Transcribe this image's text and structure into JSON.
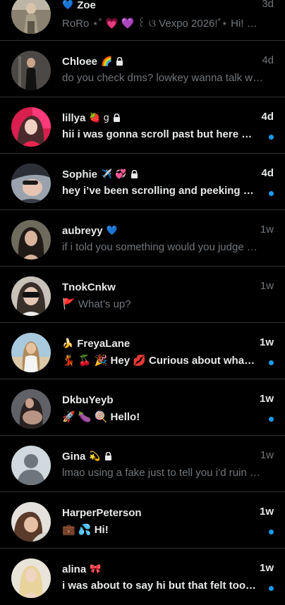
{
  "conversations": [
    {
      "name": "Zoe",
      "name_prefix_emoji": "💙",
      "name_suffix_emoji": "",
      "locked": false,
      "time": "3d",
      "preview": "RoRo ⋆˚ 💗 💜 ꒰ ଓ Vexpo 2026!˚⋆ Hi!   😤 ...",
      "unread": false,
      "avatar_icon": "photo-avatar"
    },
    {
      "name": "Chloee",
      "name_prefix_emoji": "",
      "name_suffix_emoji": "🌈",
      "locked": true,
      "time": "4d",
      "preview": "do you check dms? lowkey wanna talk with you",
      "unread": false,
      "avatar_icon": "photo-avatar"
    },
    {
      "name": "lillya",
      "name_prefix_emoji": "",
      "name_suffix_emoji": "🍓 g",
      "locked": true,
      "time": "4d",
      "preview": "hii i was gonna scroll past but here we are",
      "unread": true,
      "avatar_icon": "photo-avatar"
    },
    {
      "name": "Sophie",
      "name_prefix_emoji": "",
      "name_suffix_emoji": "✈️ 💞",
      "locked": true,
      "time": "4d",
      "preview": "hey i’ve been scrolling and peeking at your page",
      "unread": true,
      "avatar_icon": "photo-avatar"
    },
    {
      "name": "aubreyy",
      "name_prefix_emoji": "",
      "name_suffix_emoji": "💙",
      "locked": false,
      "time": "1w",
      "preview": "if i told you something would you judge me?",
      "unread": false,
      "avatar_icon": "photo-avatar"
    },
    {
      "name": "TnokCnkw",
      "name_prefix_emoji": "",
      "name_suffix_emoji": "",
      "locked": false,
      "time": "1w",
      "preview": "🚩 What’s up?",
      "unread": false,
      "avatar_icon": "photo-avatar"
    },
    {
      "name": "FreyaLane",
      "name_prefix_emoji": "🍌",
      "name_suffix_emoji": "",
      "locked": false,
      "time": "1w",
      "preview": "💃 🍒 🎉 Hey 💋 Curious about what you’re into",
      "unread": true,
      "avatar_icon": "photo-avatar"
    },
    {
      "name": "DkbuYeyb",
      "name_prefix_emoji": "",
      "name_suffix_emoji": "",
      "locked": false,
      "time": "1w",
      "preview": "🚀 🍆 🍭 Hello!",
      "unread": true,
      "avatar_icon": "photo-avatar"
    },
    {
      "name": "Gina",
      "name_prefix_emoji": "",
      "name_suffix_emoji": "💫",
      "locked": true,
      "time": "1w",
      "preview": "lmao using a fake just to tell you i’d ruin you",
      "unread": false,
      "avatar_icon": "default-avatar"
    },
    {
      "name": "HarperPeterson",
      "name_prefix_emoji": "",
      "name_suffix_emoji": "",
      "locked": false,
      "time": "1w",
      "preview": "💼 💦 Hi!",
      "unread": true,
      "avatar_icon": "photo-avatar"
    },
    {
      "name": "alina",
      "name_prefix_emoji": "",
      "name_suffix_emoji": "🎀",
      "locked": false,
      "time": "1w",
      "preview": "i was about to say hi but that felt too normal",
      "unread": true,
      "avatar_icon": "photo-avatar"
    }
  ],
  "colors": {
    "background": "#000000",
    "divider": "#2f3336",
    "primary_text": "#e7e9ea",
    "secondary_text": "#71767b",
    "unread_dot": "#1d9bf0"
  }
}
